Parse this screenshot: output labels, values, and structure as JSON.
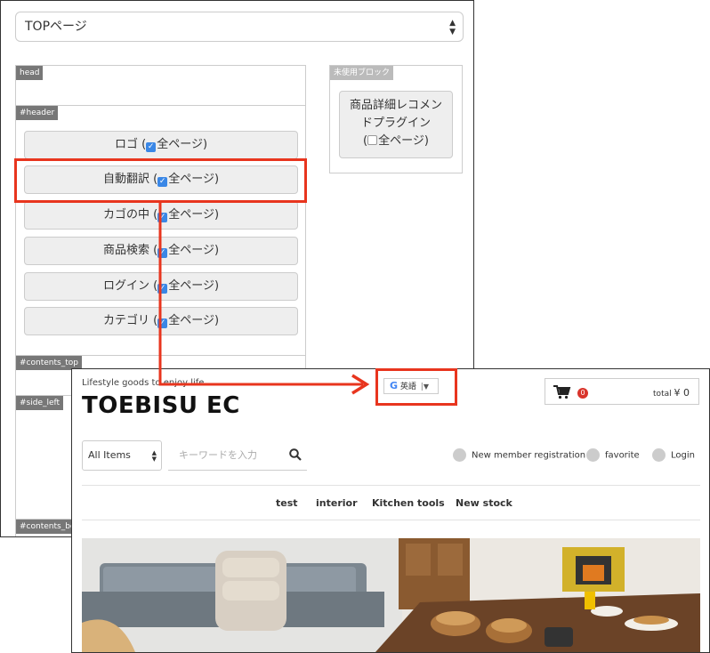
{
  "admin": {
    "page_select": "TOPページ",
    "zones": {
      "head": "head",
      "header": "#header",
      "contents_top": "#contents_top",
      "side_left": "#side_left",
      "contents_bottom": "#contents_bot"
    },
    "check_label": "全ページ)",
    "header_blocks": [
      {
        "label": "ロゴ (",
        "checked": true
      },
      {
        "label": "自動翻訳 (",
        "checked": true
      },
      {
        "label": "カゴの中 (",
        "checked": true
      },
      {
        "label": "商品検索 (",
        "checked": true
      },
      {
        "label": "ログイン (",
        "checked": true
      },
      {
        "label": "カテゴリ (",
        "checked": true
      }
    ],
    "unused": {
      "label": "未使用ブロック",
      "block_line1": "商品詳細レコメン",
      "block_line2": "ドプラグイン",
      "block_line3_prefix": "(",
      "block_line3": "全ページ)"
    }
  },
  "store": {
    "tagline": "Lifestyle goods to enjoy life",
    "logo": "TOEBISU EC",
    "translate": {
      "icon": "google-g-icon",
      "g": "G",
      "lang": "英語",
      "dropdown": "▼"
    },
    "cart": {
      "count": "0",
      "total_label": "total",
      "total_value": "¥ 0"
    },
    "category_select": "All Items",
    "search_placeholder": "キーワードを入力",
    "links": {
      "register": "New member registration",
      "favorite": "favorite",
      "login": "Login"
    },
    "nav": [
      "test",
      "interior",
      "Kitchen tools",
      "New stock"
    ]
  },
  "colors": {
    "highlight": "#e8351e",
    "checkbox": "#3a87e6",
    "badge": "#d9342b"
  }
}
